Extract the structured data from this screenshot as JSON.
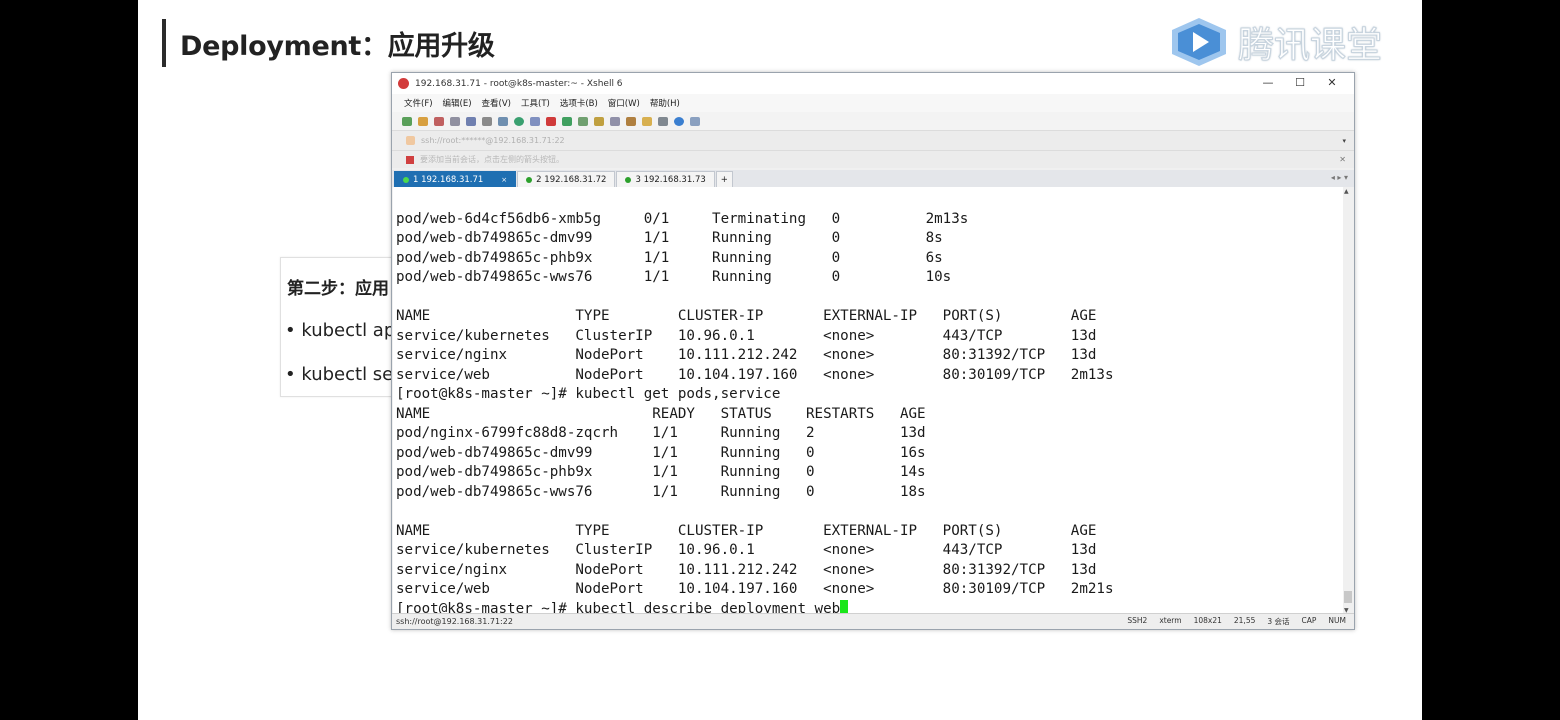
{
  "slide": {
    "title": "Deployment：应用升级",
    "logo_text": "腾讯课堂",
    "card": {
      "step": "第二步：应用",
      "bullet1": "• kubectl ap",
      "bullet2": "• kubectl se"
    }
  },
  "window": {
    "title": "192.168.31.71 - root@k8s-master:~ - Xshell 6",
    "controls": [
      "—",
      "☐",
      "✕"
    ],
    "menu": [
      "文件(F)",
      "编辑(E)",
      "查看(V)",
      "工具(T)",
      "选项卡(B)",
      "窗口(W)",
      "帮助(H)"
    ],
    "address": "ssh://root:******@192.168.31.71:22",
    "hint": "要添加当前会话，点击左侧的箭头按钮。",
    "tabs": [
      {
        "label": "1 192.168.31.71",
        "active": true
      },
      {
        "label": "2 192.168.31.72",
        "active": false
      },
      {
        "label": "3 192.168.31.73",
        "active": false
      }
    ],
    "add_tab": "+",
    "status": {
      "left": "ssh://root@192.168.31.71:22",
      "right": [
        "SSH2",
        "xterm",
        "108x21",
        "21,55",
        "3 会话",
        "CAP",
        "NUM"
      ]
    }
  },
  "terminal": {
    "lines": [
      "pod/web-6d4cf56db6-xmb5g     0/1     Terminating   0          2m13s",
      "pod/web-db749865c-dmv99      1/1     Running       0          8s",
      "pod/web-db749865c-phb9x      1/1     Running       0          6s",
      "pod/web-db749865c-wws76      1/1     Running       0          10s",
      "",
      "NAME                 TYPE        CLUSTER-IP       EXTERNAL-IP   PORT(S)        AGE",
      "service/kubernetes   ClusterIP   10.96.0.1        <none>        443/TCP        13d",
      "service/nginx        NodePort    10.111.212.242   <none>        80:31392/TCP   13d",
      "service/web          NodePort    10.104.197.160   <none>        80:30109/TCP   2m13s",
      "[root@k8s-master ~]# kubectl get pods,service",
      "NAME                          READY   STATUS    RESTARTS   AGE",
      "pod/nginx-6799fc88d8-zqcrh    1/1     Running   2          13d",
      "pod/web-db749865c-dmv99       1/1     Running   0          16s",
      "pod/web-db749865c-phb9x       1/1     Running   0          14s",
      "pod/web-db749865c-wws76       1/1     Running   0          18s",
      "",
      "NAME                 TYPE        CLUSTER-IP       EXTERNAL-IP   PORT(S)        AGE",
      "service/kubernetes   ClusterIP   10.96.0.1        <none>        443/TCP        13d",
      "service/nginx        NodePort    10.111.212.242   <none>        80:31392/TCP   13d",
      "service/web          NodePort    10.104.197.160   <none>        80:30109/TCP   2m21s"
    ],
    "prompt_line": "[root@k8s-master ~]# kubectl describe deployment web"
  },
  "colors": {
    "tab_active": "#1f6fb2",
    "cursor": "#19e619",
    "logo_blue": "#4a8fd6"
  }
}
